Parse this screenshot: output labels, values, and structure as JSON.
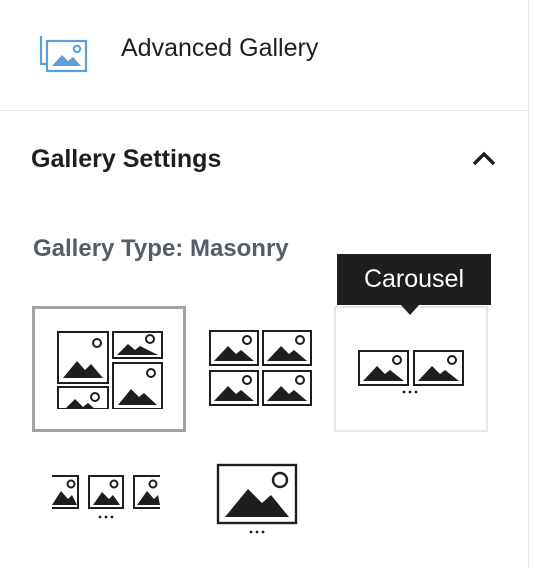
{
  "block": {
    "icon": "gallery-icon",
    "title": "Advanced Gallery"
  },
  "panel": {
    "title": "Gallery Settings",
    "toggle_icon": "chevron-up-icon"
  },
  "gallery_type": {
    "label": "Gallery Type: Masonry",
    "selected": "masonry",
    "options": [
      {
        "id": "masonry",
        "icon": "masonry-layout-icon"
      },
      {
        "id": "grid",
        "icon": "grid-layout-icon"
      },
      {
        "id": "carousel",
        "icon": "carousel-layout-icon"
      },
      {
        "id": "slider",
        "icon": "slider-layout-icon"
      },
      {
        "id": "single",
        "icon": "single-image-layout-icon"
      }
    ]
  },
  "tooltip": {
    "text": "Carousel"
  },
  "colors": {
    "icon_blue": "#5b9fd6",
    "text_dark": "#1e1e1e",
    "label_gray": "#555d66",
    "selected_border": "#a2a2a2",
    "tooltip_bg": "#1e1e1e"
  }
}
